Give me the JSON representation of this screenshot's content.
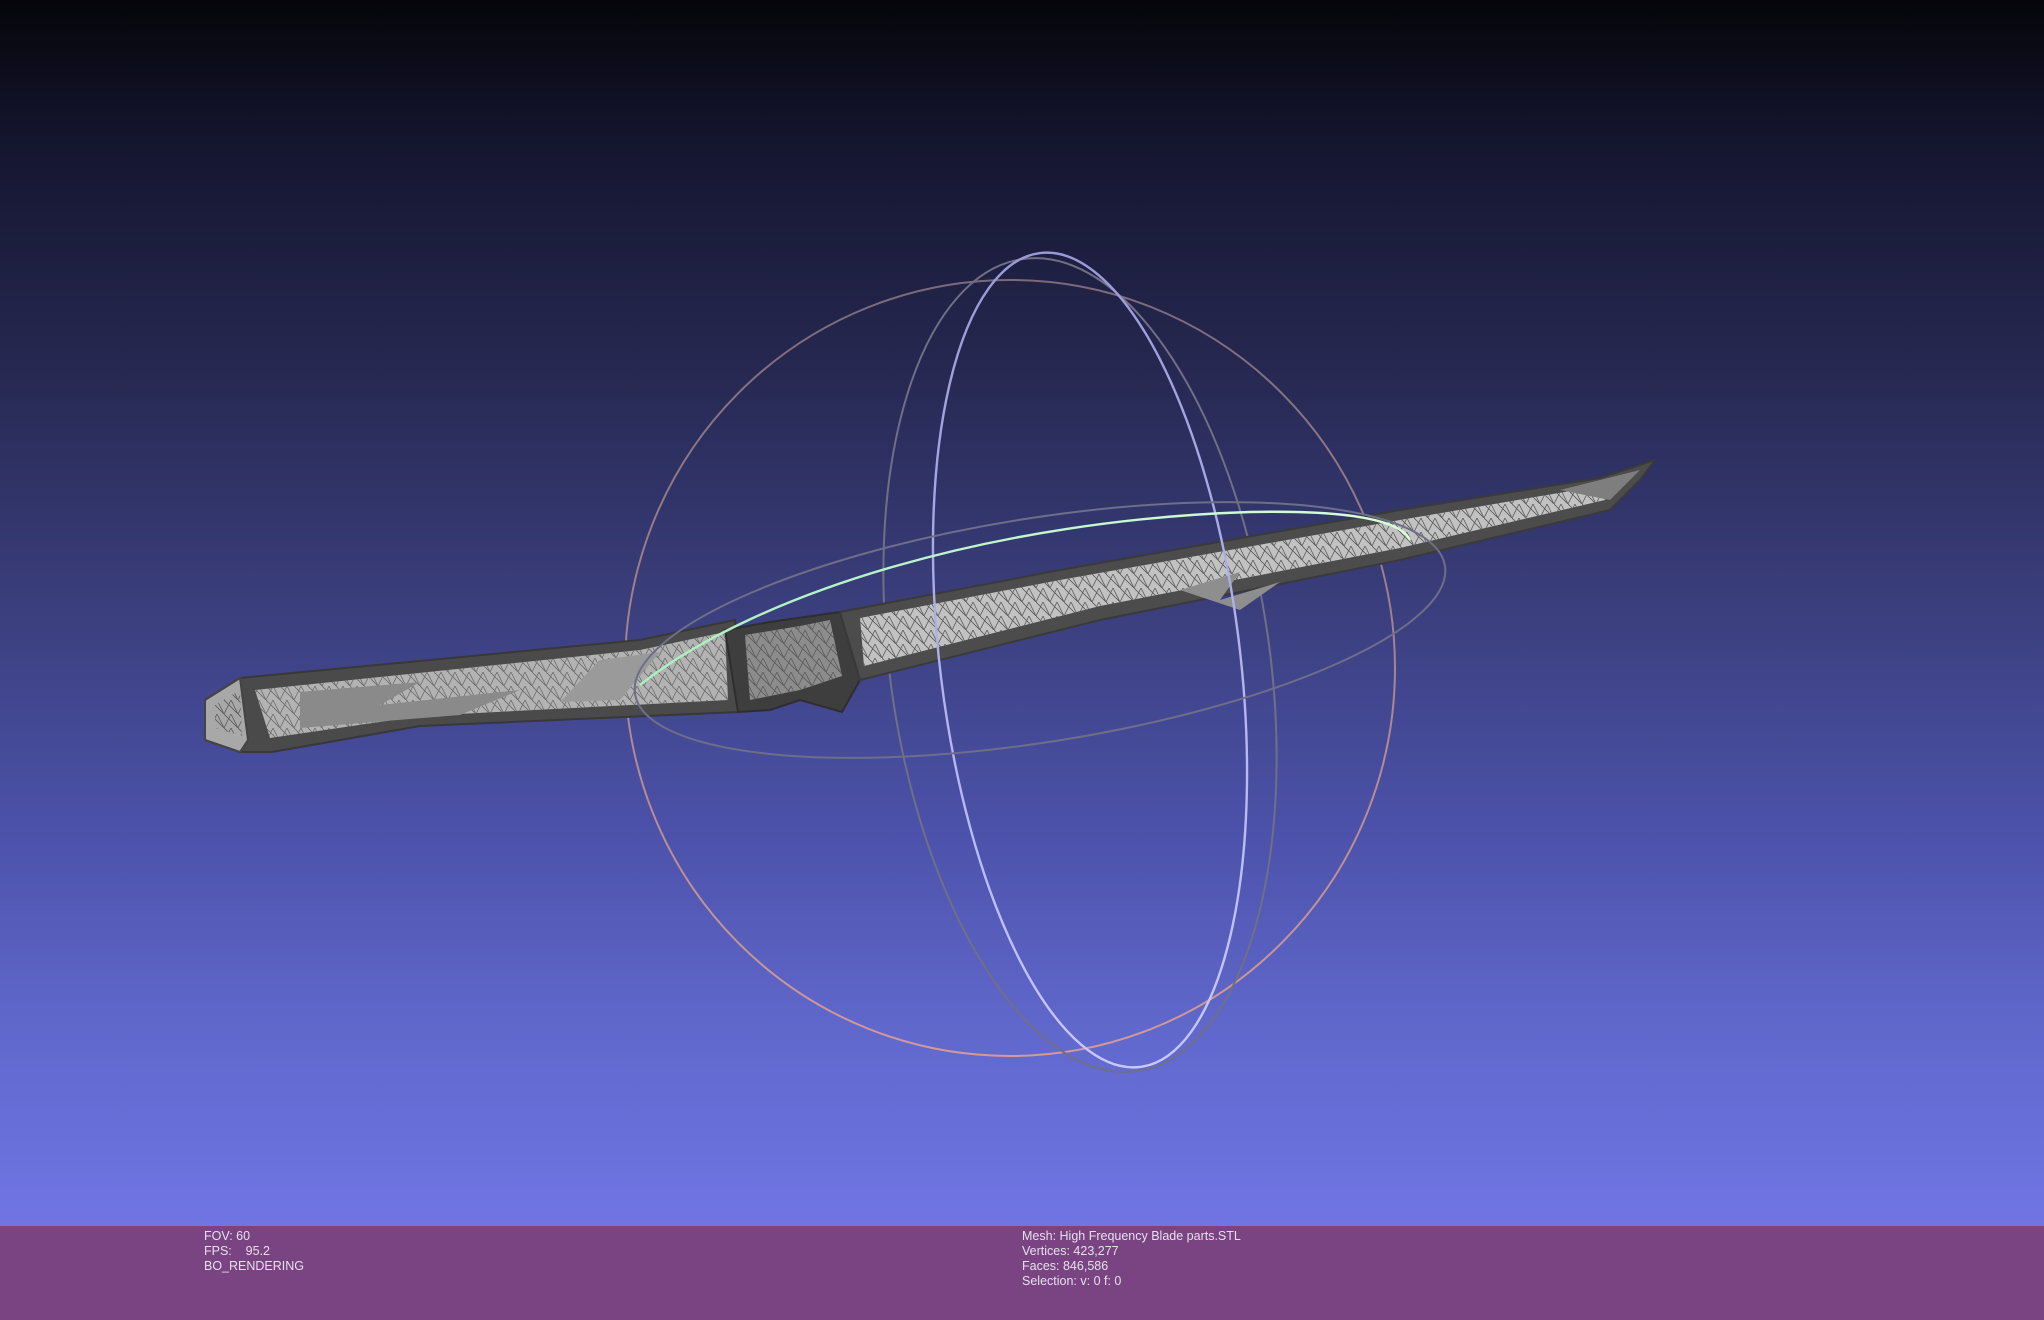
{
  "viewport": {
    "background_top": "#05050a",
    "background_bottom": "#7075e4"
  },
  "trackball": {
    "colors": {
      "x_ring": "#c9a0a8",
      "y_ring": "#b8b8ff",
      "z_ring": "#b8ffb8"
    }
  },
  "statusbar": {
    "color": "#7a4483",
    "left": {
      "fov": "FOV: 60",
      "fps": "FPS:    95.2",
      "mode": "BO_RENDERING"
    },
    "right": {
      "mesh": "Mesh: High Frequency Blade parts.STL",
      "vertices": "Vertices: 423,277",
      "faces": "Faces: 846,586",
      "selection": "Selection: v: 0 f: 0"
    }
  }
}
